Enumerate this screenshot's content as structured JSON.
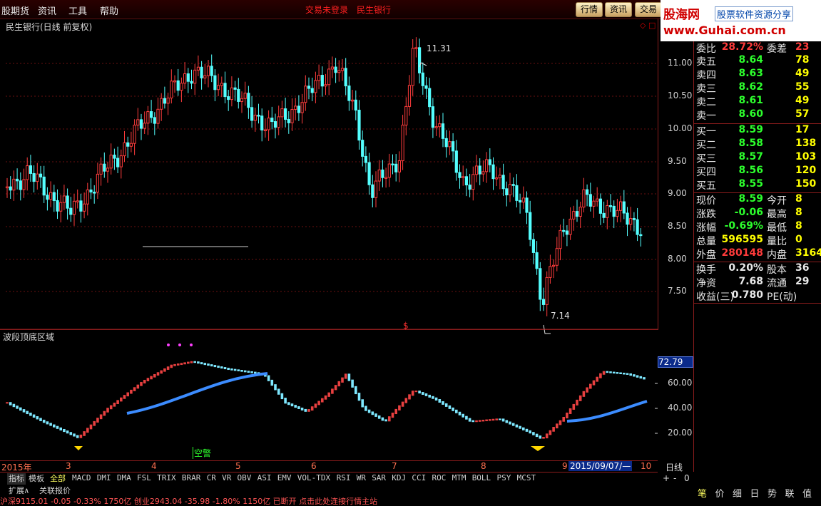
{
  "menubar": {
    "items": [
      "股期货",
      "资讯",
      "工具",
      "帮助"
    ],
    "center_text": [
      "交易未登录",
      "民生银行"
    ],
    "buttons": [
      "行情",
      "资讯",
      "交易"
    ],
    "brand": {
      "line1": "股海网",
      "line1b": "股票软件资源分享",
      "line2": "www.Guhai.com.cn"
    }
  },
  "chart": {
    "title": "民生银行(日线 前复权)",
    "price_axis": [
      "11.00",
      "10.50",
      "10.00",
      "9.50",
      "9.00",
      "8.50",
      "8.00",
      "7.50"
    ],
    "high_label": "11.31",
    "low_label": "7.14",
    "dollar_mark": "$",
    "indicator_title": "波段顶底区域",
    "indicator_value": "72.79",
    "indicator_axis": [
      "60.00",
      "40.00",
      "20.00"
    ],
    "warning_label": "空警",
    "months": [
      "2015年",
      "3",
      "4",
      "5",
      "6",
      "7",
      "8",
      "9",
      "10"
    ],
    "cursor_date": "2015/09/07/—",
    "period_label": "日线"
  },
  "chart_data": {
    "type": "candlestick",
    "price_ylim": [
      7.14,
      11.31
    ],
    "indicator_ylim": [
      0,
      80
    ],
    "high": 11.31,
    "low": 7.14
  },
  "quote": {
    "top_row": {
      "label": "委比",
      "value": "28.72%",
      "label2": "委差",
      "value2": "23"
    },
    "sells": [
      {
        "label": "卖五",
        "price": "8.64",
        "vol": "78"
      },
      {
        "label": "卖四",
        "price": "8.63",
        "vol": "49"
      },
      {
        "label": "卖三",
        "price": "8.62",
        "vol": "55"
      },
      {
        "label": "卖二",
        "price": "8.61",
        "vol": "49"
      },
      {
        "label": "卖一",
        "price": "8.60",
        "vol": "57"
      }
    ],
    "buys": [
      {
        "label": "买一",
        "price": "8.59",
        "vol": "17"
      },
      {
        "label": "买二",
        "price": "8.58",
        "vol": "138"
      },
      {
        "label": "买三",
        "price": "8.57",
        "vol": "103"
      },
      {
        "label": "买四",
        "price": "8.56",
        "vol": "120"
      },
      {
        "label": "买五",
        "price": "8.55",
        "vol": "150"
      }
    ],
    "stats": [
      {
        "l1": "现价",
        "v1": "8.59",
        "c1": "green",
        "l2": "今开",
        "v2": "8"
      },
      {
        "l1": "涨跌",
        "v1": "-0.06",
        "c1": "green",
        "l2": "最高",
        "v2": "8"
      },
      {
        "l1": "涨幅",
        "v1": "-0.69%",
        "c1": "green",
        "l2": "最低",
        "v2": "8"
      },
      {
        "l1": "总量",
        "v1": "596595",
        "c1": "yellow",
        "l2": "量比",
        "v2": "0"
      },
      {
        "l1": "外盘",
        "v1": "280148",
        "c1": "red",
        "l2": "内盘",
        "v2": "3164"
      }
    ],
    "stats2": [
      {
        "l1": "换手",
        "v1": "0.20%",
        "l2": "股本",
        "v2": "36"
      },
      {
        "l1": "净资",
        "v1": "7.68",
        "l2": "流通",
        "v2": "29"
      },
      {
        "l1": "收益(三)",
        "v1": "0.780",
        "l2": "PE(动)",
        "v2": ""
      }
    ]
  },
  "tabs": {
    "left": [
      "指标",
      "模板",
      "全部"
    ],
    "indicators": [
      "MACD",
      "DMI",
      "DMA",
      "FSL",
      "TRIX",
      "BRAR",
      "CR",
      "VR",
      "OBV",
      "ASI",
      "EMV",
      "VOL-TDX",
      "RSI",
      "WR",
      "SAR",
      "KDJ",
      "CCI",
      "ROC",
      "MTM",
      "BOLL",
      "PSY",
      "MCST"
    ],
    "row2": [
      "扩展∧",
      "关联报价"
    ],
    "right_controls": [
      "+",
      "-",
      "0"
    ],
    "right_tabs": [
      "笔",
      "价",
      "细",
      "日",
      "势",
      "联",
      "值"
    ]
  },
  "ticker": {
    "text": "沪深9115.01  -0.05  -0.33%  1750亿  创业2943.04  -35.98  -1.80%  1150亿        已断开    点击此处连接行情主站"
  }
}
